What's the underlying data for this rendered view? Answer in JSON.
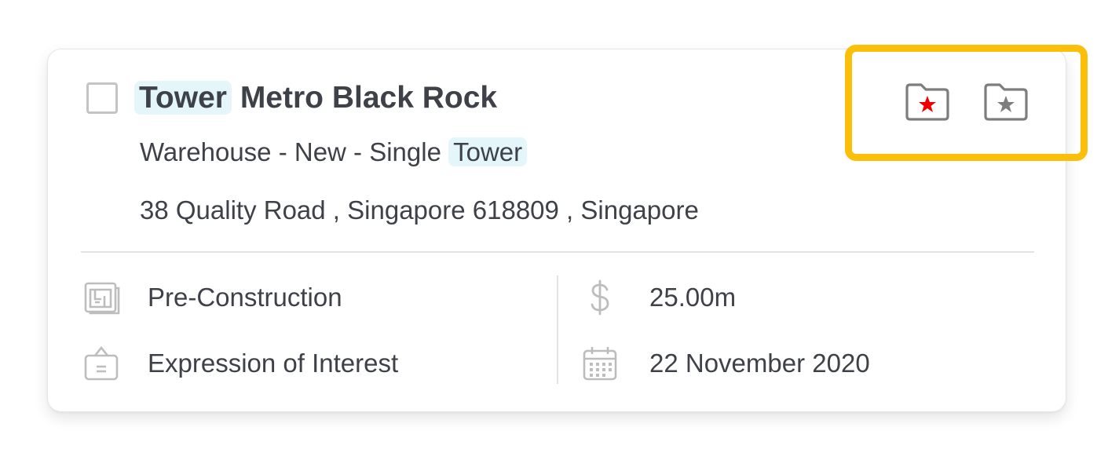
{
  "card": {
    "title_highlight": "Tower",
    "title_rest": "Metro Black Rock",
    "subtitle_prefix": "Warehouse - New - Single ",
    "subtitle_highlight": "Tower",
    "address": "38 Quality Road , Singapore 618809 , Singapore",
    "stage": "Pre-Construction",
    "tender_type": "Expression of Interest",
    "value": "25.00m",
    "date": "22 November 2020"
  },
  "actions": {
    "folder_star_red_icon": "folder-star-red-icon",
    "folder_star_gray_icon": "folder-star-gray-icon"
  },
  "colors": {
    "highlight_bg": "#e4f6fa",
    "annotation_border": "#fbbf0a",
    "star_red": "#f00000",
    "icon_gray": "#7d7d7d"
  }
}
